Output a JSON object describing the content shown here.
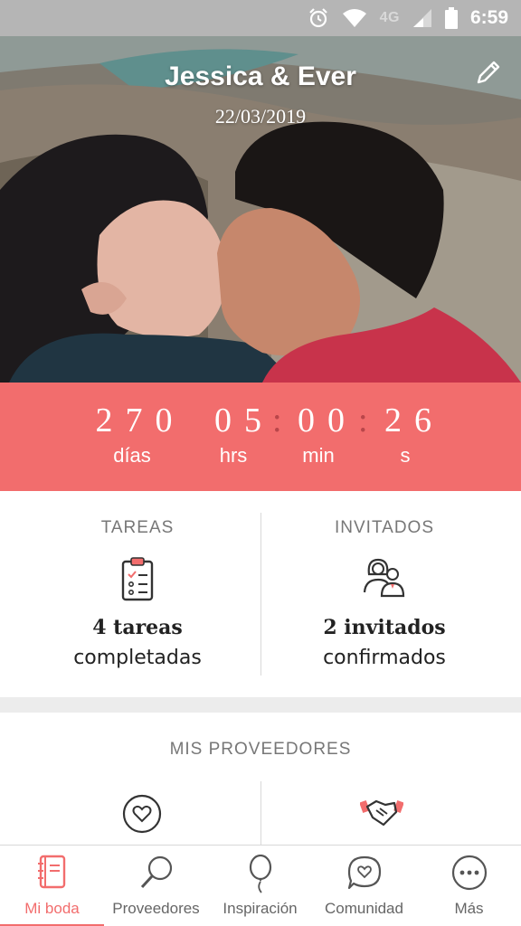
{
  "status_bar": {
    "network": "4G",
    "time": "6:59",
    "icons": [
      "alarm-icon",
      "wifi-icon",
      "signal-icon",
      "battery-icon"
    ]
  },
  "hero": {
    "names": "Jessica & Ever",
    "date": "22/03/2019",
    "edit_icon": "pencil-icon"
  },
  "countdown": {
    "days": "270",
    "hours": "05",
    "minutes": "00",
    "seconds": "26",
    "separator": ":",
    "labels": {
      "days": "días",
      "hours": "hrs",
      "minutes": "min",
      "seconds": "s"
    }
  },
  "tasks": {
    "title": "TAREAS",
    "icon": "clipboard-checklist-icon",
    "count_text": "4 tareas",
    "status_text": "completadas"
  },
  "guests": {
    "title": "INVITADOS",
    "icon": "couple-guests-icon",
    "count_text": "2 invitados",
    "status_text": "confirmados"
  },
  "providers": {
    "title": "MIS PROVEEDORES",
    "icons": [
      "heart-circle-icon",
      "handshake-icon"
    ]
  },
  "bottom_nav": {
    "items": [
      {
        "label": "Mi boda",
        "icon": "notebook-icon",
        "active": true
      },
      {
        "label": "Proveedores",
        "icon": "magnifier-icon",
        "active": false
      },
      {
        "label": "Inspiración",
        "icon": "balloon-icon",
        "active": false
      },
      {
        "label": "Comunidad",
        "icon": "chat-heart-icon",
        "active": false
      },
      {
        "label": "Más",
        "icon": "more-dots-icon",
        "active": false
      }
    ]
  },
  "colors": {
    "accent": "#f26d6d",
    "status_bar": "#b5b5b5",
    "background": "#ececec"
  }
}
